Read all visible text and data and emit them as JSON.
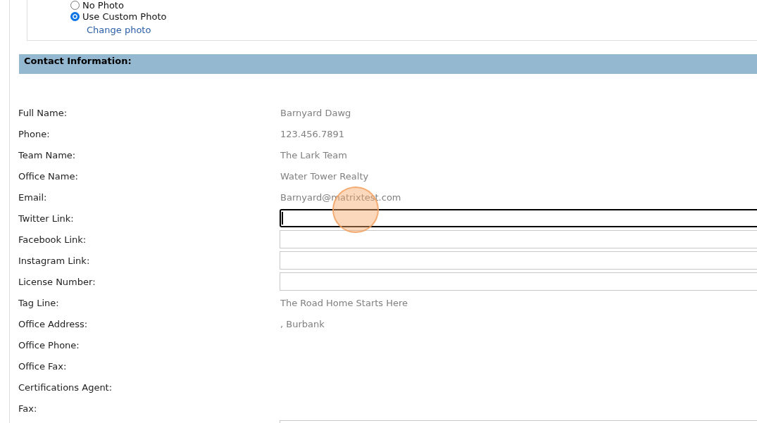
{
  "photo_options": [
    {
      "label": "No Photo",
      "selected": false
    },
    {
      "label": "Use Custom Photo",
      "selected": true,
      "link": "Change photo"
    }
  ],
  "section": {
    "title": "Contact Information:"
  },
  "rows": [
    {
      "label": "Full Name:",
      "kind": "text",
      "value": "Barnyard Dawg"
    },
    {
      "label": "Phone:",
      "kind": "text",
      "value": "123.456.7891"
    },
    {
      "label": "Team Name:",
      "kind": "text",
      "value": "The Lark Team"
    },
    {
      "label": "Office Name:",
      "kind": "text",
      "value": "Water Tower Realty"
    },
    {
      "label": "Email:",
      "kind": "text",
      "value": "Barnyard@matrixtest.com"
    },
    {
      "label": "Twitter Link:",
      "kind": "input",
      "focused": true
    },
    {
      "label": "Facebook Link:",
      "kind": "input",
      "focused": false
    },
    {
      "label": "Instagram Link:",
      "kind": "input",
      "focused": false
    },
    {
      "label": "License Number:",
      "kind": "input",
      "focused": false
    },
    {
      "label": "Tag Line:",
      "kind": "text",
      "value": "The Road Home Starts Here"
    },
    {
      "label": "Office Address:",
      "kind": "text",
      "value": ", Burbank"
    },
    {
      "label": "Office Phone:",
      "kind": "text"
    },
    {
      "label": "Office Fax:",
      "kind": "text"
    },
    {
      "label": "Certifications Agent:",
      "kind": "text"
    },
    {
      "label": "Fax:",
      "kind": "text"
    },
    {
      "kind": "input",
      "focused": false
    }
  ]
}
